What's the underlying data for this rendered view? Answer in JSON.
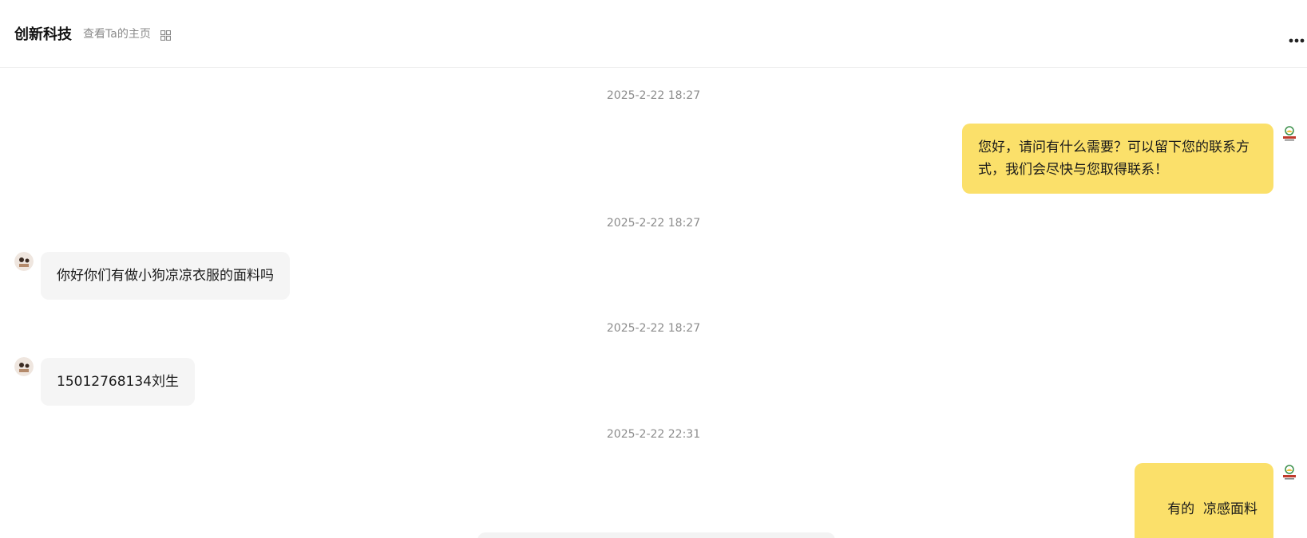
{
  "header": {
    "title": "创新科技",
    "profile_link": "查看Ta的主页",
    "qr_icon": "qr-code-icon",
    "more_icon": "more-dots-icon"
  },
  "messages": [
    {
      "timestamp": "2025-2-22 18:27",
      "sender": "me",
      "text": "您好，请问有什么需要？可以留下您的联系方式，我们会尽快与您取得联系！"
    },
    {
      "timestamp": "2025-2-22 18:27",
      "sender": "them",
      "text": "你好你们有做小狗凉凉衣服的面料吗"
    },
    {
      "timestamp": "2025-2-22 18:27",
      "sender": "them",
      "text": "15012768134刘生"
    },
    {
      "timestamp": "2025-2-22 22:31",
      "sender": "me",
      "text": "有的  凉感面料"
    }
  ],
  "colors": {
    "my_bubble": "#fbe06a",
    "their_bubble": "#f5f5f5",
    "timestamp": "#8c8c8c"
  }
}
